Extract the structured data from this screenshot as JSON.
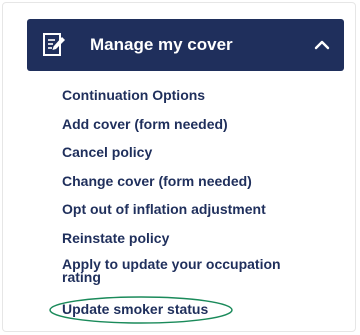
{
  "panel": {
    "title": "Manage my cover",
    "header_icon": "document-edit-icon",
    "toggle_icon": "chevron-up-icon",
    "header_color": "#1f2f5c",
    "link_color": "#1f2f5c",
    "highlight_color": "#1a8a5a"
  },
  "menu": {
    "items": [
      {
        "label": "Continuation Options"
      },
      {
        "label": "Add cover (form needed)"
      },
      {
        "label": "Cancel policy"
      },
      {
        "label": "Change cover (form needed)"
      },
      {
        "label": "Opt out of inflation adjustment"
      },
      {
        "label": "Reinstate policy"
      },
      {
        "label": "Apply to update your occupation rating"
      },
      {
        "label": "Update smoker status"
      }
    ]
  }
}
